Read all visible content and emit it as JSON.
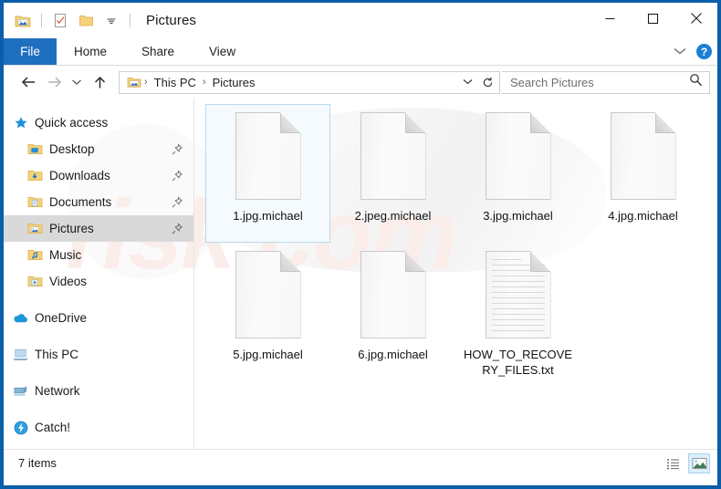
{
  "window": {
    "title": "Pictures",
    "border_color": "#0b5ea8",
    "watermark_text": "risk.com"
  },
  "quick_access_toolbar": {
    "items": [
      {
        "name": "explorer-icon",
        "tooltip": "File Explorer"
      },
      {
        "name": "properties-icon",
        "tooltip": "Properties"
      },
      {
        "name": "new-folder-icon",
        "tooltip": "New folder"
      },
      {
        "name": "customize-icon",
        "tooltip": "Customize Quick Access Toolbar"
      }
    ]
  },
  "window_controls": {
    "minimize": "–",
    "maximize": "□",
    "close": "✕"
  },
  "ribbon": {
    "file_tab": "File",
    "tabs": [
      "Home",
      "Share",
      "View"
    ],
    "expand_label": "⌄",
    "help_label": "?",
    "accent_color": "#1f6fc0"
  },
  "address_bar": {
    "back": "←",
    "forward": "→",
    "history": "⌄",
    "up": "↑",
    "breadcrumbs": [
      "This PC",
      "Pictures"
    ],
    "separator": "›",
    "dropdown": "⌄",
    "refresh": "↻",
    "search_placeholder": "Search Pictures",
    "search_value": ""
  },
  "sidebar": {
    "groups": [
      {
        "root": {
          "label": "Quick access",
          "icon": "star-icon"
        },
        "items": [
          {
            "label": "Desktop",
            "icon": "folder-desktop-icon",
            "pinned": true,
            "selected": false
          },
          {
            "label": "Downloads",
            "icon": "folder-downloads-icon",
            "pinned": true,
            "selected": false
          },
          {
            "label": "Documents",
            "icon": "folder-documents-icon",
            "pinned": true,
            "selected": false
          },
          {
            "label": "Pictures",
            "icon": "folder-pictures-icon",
            "pinned": true,
            "selected": true
          },
          {
            "label": "Music",
            "icon": "folder-music-icon",
            "pinned": false,
            "selected": false
          },
          {
            "label": "Videos",
            "icon": "folder-videos-icon",
            "pinned": false,
            "selected": false
          }
        ]
      },
      {
        "root": {
          "label": "OneDrive",
          "icon": "onedrive-cloud-icon"
        },
        "items": []
      },
      {
        "root": {
          "label": "This PC",
          "icon": "this-pc-icon"
        },
        "items": []
      },
      {
        "root": {
          "label": "Network",
          "icon": "network-icon"
        },
        "items": []
      },
      {
        "root": {
          "label": "Catch!",
          "icon": "catch-app-icon"
        },
        "items": []
      }
    ]
  },
  "files": [
    {
      "name": "1.jpg.michael",
      "icon": "blank-document-icon",
      "selected": true
    },
    {
      "name": "2.jpeg.michael",
      "icon": "blank-document-icon",
      "selected": false
    },
    {
      "name": "3.jpg.michael",
      "icon": "blank-document-icon",
      "selected": false
    },
    {
      "name": "4.jpg.michael",
      "icon": "blank-document-icon",
      "selected": false
    },
    {
      "name": "5.jpg.michael",
      "icon": "blank-document-icon",
      "selected": false
    },
    {
      "name": "6.jpg.michael",
      "icon": "blank-document-icon",
      "selected": false
    },
    {
      "name": "HOW_TO_RECOVERY_FILES.txt",
      "icon": "text-document-icon",
      "selected": false
    }
  ],
  "status_bar": {
    "item_count": "7 items",
    "views": [
      {
        "name": "details-view",
        "active": false
      },
      {
        "name": "large-icons-view",
        "active": true
      }
    ]
  }
}
